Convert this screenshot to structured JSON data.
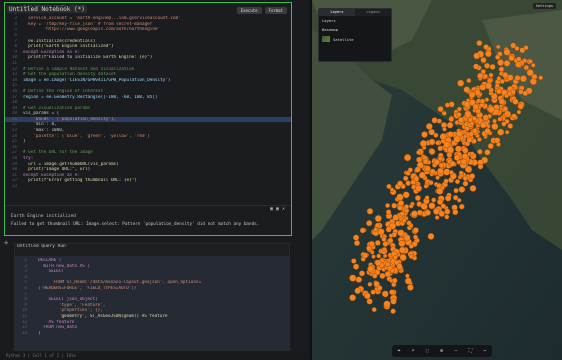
{
  "notebook": {
    "cell1": {
      "title": "Untitled Notebook (*)",
      "buttons": [
        "Execute",
        "Format"
      ],
      "lines": [
        {
          "n": "",
          "t": "# Visualize Earth Engine",
          "k": "com"
        },
        {
          "n": "2",
          "t": "",
          "k": "plain"
        },
        {
          "n": "3",
          "t": "  service_account = 'earth-engine@...iam.gserviceaccount.com'",
          "k": "str"
        },
        {
          "n": "4",
          "t": "  key = '/tmp/key-file.json' # from secret-manager",
          "k": "str"
        },
        {
          "n": "5",
          "t": "        'https://www.googleapis.com/auth/earthengine'",
          "k": "str"
        },
        {
          "n": "6",
          "t": "",
          "k": "plain"
        },
        {
          "n": "7",
          "t": "  ee.Initialize(credentials)",
          "k": "fn"
        },
        {
          "n": "8",
          "t": "  print(\"Earth Engine initialized\")",
          "k": "fn"
        },
        {
          "n": "9",
          "t": "except Exception as e:",
          "k": "kw"
        },
        {
          "n": "10",
          "t": "  print(f\"Failed to initialize Earth Engine: {e}\")",
          "k": "fn"
        },
        {
          "n": "11",
          "t": "",
          "k": "plain"
        },
        {
          "n": "12",
          "t": "# Define a sample dataset and visualization",
          "k": "com"
        },
        {
          "n": "13",
          "t": "# Get the population density dataset",
          "k": "com"
        },
        {
          "n": "14",
          "t": "image = ee.Image('CIESIN/GPWv411/GPW_Population_Density')",
          "k": "id"
        },
        {
          "n": "15",
          "t": "",
          "k": "plain"
        },
        {
          "n": "16",
          "t": "# Define the region of interest",
          "k": "com"
        },
        {
          "n": "17",
          "t": "region = ee.Geometry.Rectangle([-180, -60, 180, 85])",
          "k": "id"
        },
        {
          "n": "18",
          "t": "",
          "k": "plain"
        },
        {
          "n": "19",
          "t": "# Get visualization params",
          "k": "com"
        },
        {
          "n": "20",
          "t": "vis_params = {",
          "k": "plain"
        },
        {
          "n": "21",
          "t": "    'bands': ['population_density'],",
          "k": "str"
        },
        {
          "n": "22",
          "t": "    'min': 0,",
          "k": "plain"
        },
        {
          "n": "23",
          "t": "    'max': 1000,",
          "k": "plain"
        },
        {
          "n": "24",
          "t": "    'palette': ['blue', 'green', 'yellow', 'red']",
          "k": "str"
        },
        {
          "n": "25",
          "t": "}",
          "k": "plain"
        },
        {
          "n": "26",
          "t": "",
          "k": "plain"
        },
        {
          "n": "27",
          "t": "# Get the URL for the image",
          "k": "com"
        },
        {
          "n": "28",
          "t": "try:",
          "k": "kw"
        },
        {
          "n": "29",
          "t": "  url = image.getThumbURL(vis_params)",
          "k": "fn"
        },
        {
          "n": "30",
          "t": "  print(\"Image URL:\", url)",
          "k": "fn"
        },
        {
          "n": "31",
          "t": "except Exception as e:",
          "k": "kw"
        },
        {
          "n": "32",
          "t": "  print(f\"Error getting thumbnail URL: {e}\")",
          "k": "fn"
        },
        {
          "n": "33",
          "t": "",
          "k": "plain"
        }
      ],
      "output_title": "Earth Engine initialized",
      "output_text": "Failed to get thumbnail URL: Image.select: Pattern 'population_density' did not match any bands.",
      "output_icons": "▣ ▣ ✕"
    },
    "add_cell": "+",
    "cell2": {
      "title": "Untitled Query Run",
      "lines": [
        {
          "n": "1",
          "t": "  DECLARE (",
          "k": "kw"
        },
        {
          "n": "2",
          "t": "    WITH new_data AS (",
          "k": "kw"
        },
        {
          "n": "3",
          "t": "      SELECT",
          "k": "kw"
        },
        {
          "n": "4",
          "t": "",
          "k": "plain"
        },
        {
          "n": "5",
          "t": "        FROM ST_Read('/data/monaco-layout.geojson', open_options=",
          "k": "str"
        },
        {
          "n": "6",
          "t": "  ['HEADERS=FORCE', 'FIELD_TYPES=AUTO'])",
          "k": "str"
        },
        {
          "n": "7",
          "t": "",
          "k": "plain"
        },
        {
          "n": "8",
          "t": "      SELECT json_object(",
          "k": "kw"
        },
        {
          "n": "9",
          "t": "          'type', 'Feature',",
          "k": "str"
        },
        {
          "n": "10",
          "t": "          'properties', {},",
          "k": "str"
        },
        {
          "n": "11",
          "t": "          'geometry', ST_AsGeoJSON(geom)) AS feature",
          "k": "fn"
        },
        {
          "n": "12",
          "t": "      AS feature",
          "k": "kw"
        },
        {
          "n": "13",
          "t": "    FROM new_data",
          "k": "kw"
        },
        {
          "n": "14",
          "t": "  )",
          "k": "plain"
        }
      ]
    },
    "statusbar": "Python 3 | Cell 1 of 2 | Idle"
  },
  "map": {
    "panel_tabs": [
      "Layers",
      "Legend"
    ],
    "panel_active": "Layers",
    "layers_label": "Layers",
    "basemap_label": "Basemap",
    "layer_name": "Satellite",
    "top_button": "Settings",
    "tools": [
      "⌖",
      "⌕",
      "⬚",
      "⊕",
      "−",
      "⛶",
      "⋯"
    ]
  },
  "colors": {
    "point": "#f5831f",
    "cell_border": "#3cbf4a"
  }
}
